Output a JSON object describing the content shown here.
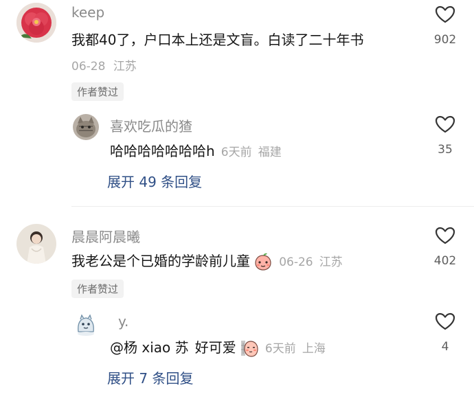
{
  "comments": [
    {
      "username": "keep",
      "text": "我都40了，户口本上还是文盲。白读了二十年书",
      "date": "06-28",
      "location": "江苏",
      "author_liked_badge": "作者赞过",
      "like_count": "902",
      "reply": {
        "username": "喜欢吃瓜的猹",
        "text": "哈哈哈哈哈哈哈h",
        "time": "6天前",
        "location": "福建",
        "like_count": "35"
      },
      "expand_label": "展开 49 条回复"
    },
    {
      "username": "晨晨阿晨曦",
      "text": "我老公是个已婚的学龄前儿童",
      "date": "06-26",
      "location": "江苏",
      "author_liked_badge": "作者赞过",
      "like_count": "402",
      "reply": {
        "username": "y.",
        "mention": "@杨 xiao 苏",
        "text": "好可爱",
        "time": "6天前",
        "location": "上海",
        "like_count": "4"
      },
      "expand_label": "展开 7 条回复"
    }
  ],
  "icons": {
    "like": "heart-outline-icon",
    "emoji_peach": "peach-face-emoji",
    "emoji_shy": "shy-face-emoji"
  },
  "colors": {
    "username": "#8a8a8a",
    "text": "#161616",
    "meta": "#a6a6a6",
    "expand_link": "#2f4f86",
    "badge_bg": "#f2f2f2"
  }
}
